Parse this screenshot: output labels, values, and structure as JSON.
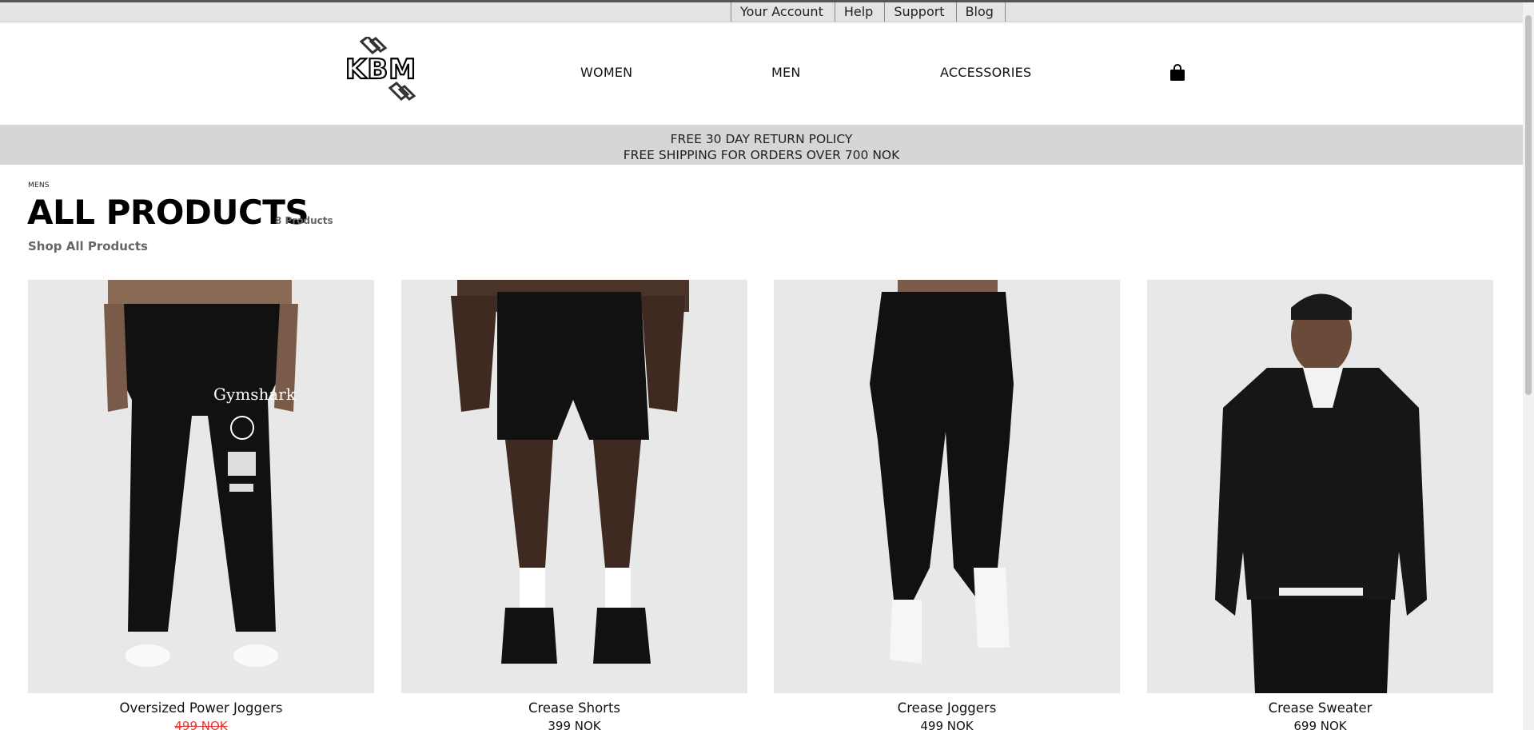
{
  "utility_nav": [
    "Your Account",
    "Help",
    "Support",
    "Blog"
  ],
  "brand": {
    "logo_text": "KBM"
  },
  "main_nav": {
    "women": "WOMEN",
    "men": "MEN",
    "accessories": "ACCESSORIES"
  },
  "cart_icon": "shopping-bag-icon",
  "promo": {
    "line1": "FREE 30 DAY RETURN POLICY",
    "line2": "FREE SHIPPING FOR ORDERS OVER 700 NOK"
  },
  "breadcrumb": "MENS",
  "page_title": "ALL PRODUCTS",
  "product_count": "8 Products",
  "shop_all_link": "Shop All Products",
  "products": [
    {
      "name": "Oversized Power Joggers",
      "price": "499 NOK",
      "price_on_sale_strikethrough": true
    },
    {
      "name": "Crease Shorts",
      "price": "399 NOK",
      "price_on_sale_strikethrough": false
    },
    {
      "name": "Crease Joggers",
      "price": "499 NOK",
      "price_on_sale_strikethrough": false
    },
    {
      "name": "Crease Sweater",
      "price": "699 NOK",
      "price_on_sale_strikethrough": false
    }
  ],
  "colors": {
    "promo_bg": "#d6d6d6",
    "utility_bg": "#e3e3e3",
    "sale_price": "#e53935",
    "product_bg": "#e6e6e6"
  }
}
